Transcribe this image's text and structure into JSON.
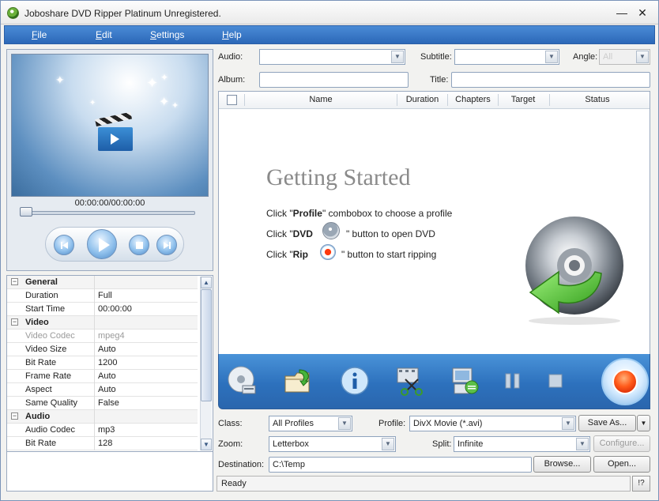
{
  "window": {
    "title": "Joboshare DVD Ripper Platinum Unregistered.",
    "minimize": "—",
    "close": "✕"
  },
  "menu": [
    "File",
    "Edit",
    "Settings",
    "Help"
  ],
  "player": {
    "timecode": "00:00:00/00:00:00",
    "seek_position": 0
  },
  "properties": [
    {
      "type": "category",
      "expander": "−",
      "name": "General"
    },
    {
      "type": "row",
      "name": "Duration",
      "value": "Full"
    },
    {
      "type": "row",
      "name": "Start Time",
      "value": "00:00:00"
    },
    {
      "type": "category",
      "expander": "−",
      "name": "Video"
    },
    {
      "type": "row",
      "name": "Video Codec",
      "value": "mpeg4",
      "disabled": true
    },
    {
      "type": "row",
      "name": "Video Size",
      "value": "Auto"
    },
    {
      "type": "row",
      "name": "Bit Rate",
      "value": "1200"
    },
    {
      "type": "row",
      "name": "Frame Rate",
      "value": "Auto"
    },
    {
      "type": "row",
      "name": "Aspect",
      "value": "Auto"
    },
    {
      "type": "row",
      "name": "Same Quality",
      "value": "False"
    },
    {
      "type": "category",
      "expander": "−",
      "name": "Audio"
    },
    {
      "type": "row",
      "name": "Audio Codec",
      "value": "mp3"
    },
    {
      "type": "row",
      "name": "Bit Rate",
      "value": "128"
    }
  ],
  "top_fields": {
    "audio_label": "Audio:",
    "audio_value": "",
    "subtitle_label": "Subtitle:",
    "subtitle_value": "",
    "angle_label": "Angle:",
    "angle_value": "All",
    "album_label": "Album:",
    "album_value": "",
    "title_label": "Title:",
    "title_value": ""
  },
  "list": {
    "columns": [
      "Name",
      "Duration",
      "Chapters",
      "Target",
      "Status"
    ]
  },
  "getting_started": {
    "title": "Getting Started",
    "line1_pre": "Click \"",
    "line1_bold": "Profile",
    "line1_post": "\" combobox to choose a profile",
    "line2_pre": "Click \"",
    "line2_bold": "DVD",
    "line2_post": "\" button to open DVD",
    "line3_pre": "Click \"",
    "line3_bold": "Rip",
    "line3_post": "\" button to start ripping"
  },
  "toolbar": {
    "buttons": [
      "open-dvd-icon",
      "load-folder-icon",
      "info-icon",
      "trim-icon",
      "add-profile-icon",
      "pause-icon",
      "stop-icon",
      "rip-icon"
    ]
  },
  "bottom_fields": {
    "class_label": "Class:",
    "class_value": "All Profiles",
    "profile_label": "Profile:",
    "profile_value": "DivX Movie  (*.avi)",
    "save_as": "Save As...",
    "zoom_label": "Zoom:",
    "zoom_value": "Letterbox",
    "split_label": "Split:",
    "split_value": "Infinite",
    "configure": "Configure...",
    "destination_label": "Destination:",
    "destination_value": "C:\\Temp",
    "browse": "Browse...",
    "open": "Open..."
  },
  "status": {
    "text": "Ready",
    "help": "!?"
  },
  "colors": {
    "menubar": "#2c68b8",
    "toolbar": "#2d71bd",
    "rip_button": "#ff5a1a"
  }
}
